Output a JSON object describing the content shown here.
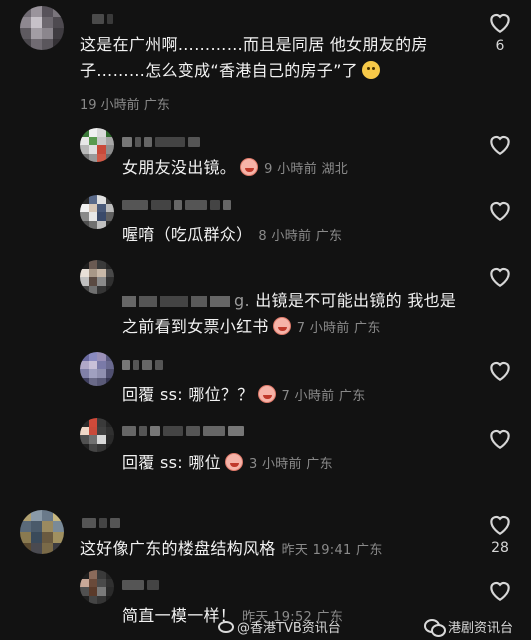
{
  "comments": [
    {
      "text": "这是在广州啊…………而且是同居 他女朋友的房子………怎么变成“香港自己的房子”了",
      "time": "19 小時前",
      "location": "广东",
      "likes": "6"
    },
    {
      "text": "女朋友没出镜。",
      "time": "9 小時前",
      "location": "湖北",
      "likes": ""
    },
    {
      "text": "喔唷（吃瓜群众）",
      "time": "8 小時前",
      "location": "广东",
      "likes": ""
    },
    {
      "text_prefix": "g. ",
      "text": "出镜是不可能出镜的 我也是之前看到女票小红书",
      "time": "7 小時前",
      "location": "广东",
      "likes": ""
    },
    {
      "text": "回覆 ss: 哪位？？",
      "time": "7 小時前",
      "location": "广东",
      "likes": ""
    },
    {
      "text": "回覆 ss: 哪位",
      "time": "3 小時前",
      "location": "广东",
      "likes": ""
    },
    {
      "text": "这好像广东的楼盘结构风格",
      "time": "昨天 19:41",
      "location": "广东",
      "likes": "28"
    },
    {
      "text": "简直一模一样！",
      "time": "昨天 19:52",
      "location": "广东",
      "likes": ""
    }
  ],
  "watermarks": {
    "weibo": "@香港TVB资讯台",
    "wechat": "港剧资讯台"
  },
  "colors": {
    "background": "#121212",
    "meta": "#8a8a8a"
  }
}
